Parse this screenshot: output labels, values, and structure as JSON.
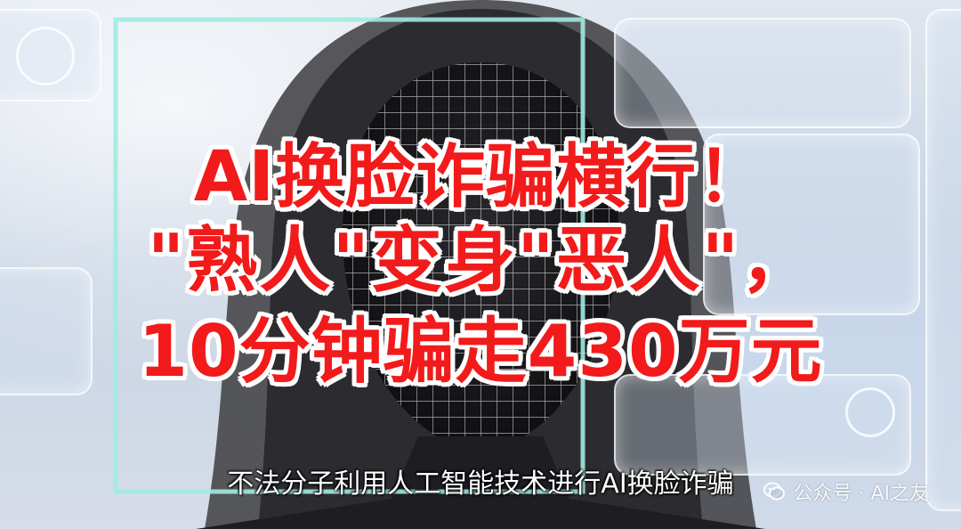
{
  "headline": {
    "line1": "AI换脸诈骗横行！",
    "line2": "\"熟人\"变身\"恶人\"，",
    "line3": "10分钟骗走430万元"
  },
  "subtitle": "不法分子利用人工智能技术进行AI换脸诈骗",
  "watermark": {
    "text": "公众号 · AI之友",
    "icon": "wechat-icon"
  },
  "colors": {
    "headline": "#f21a1a",
    "outline": "#ffffff",
    "subtitle": "#ffffff",
    "scan_bracket": "#bfeff0"
  }
}
